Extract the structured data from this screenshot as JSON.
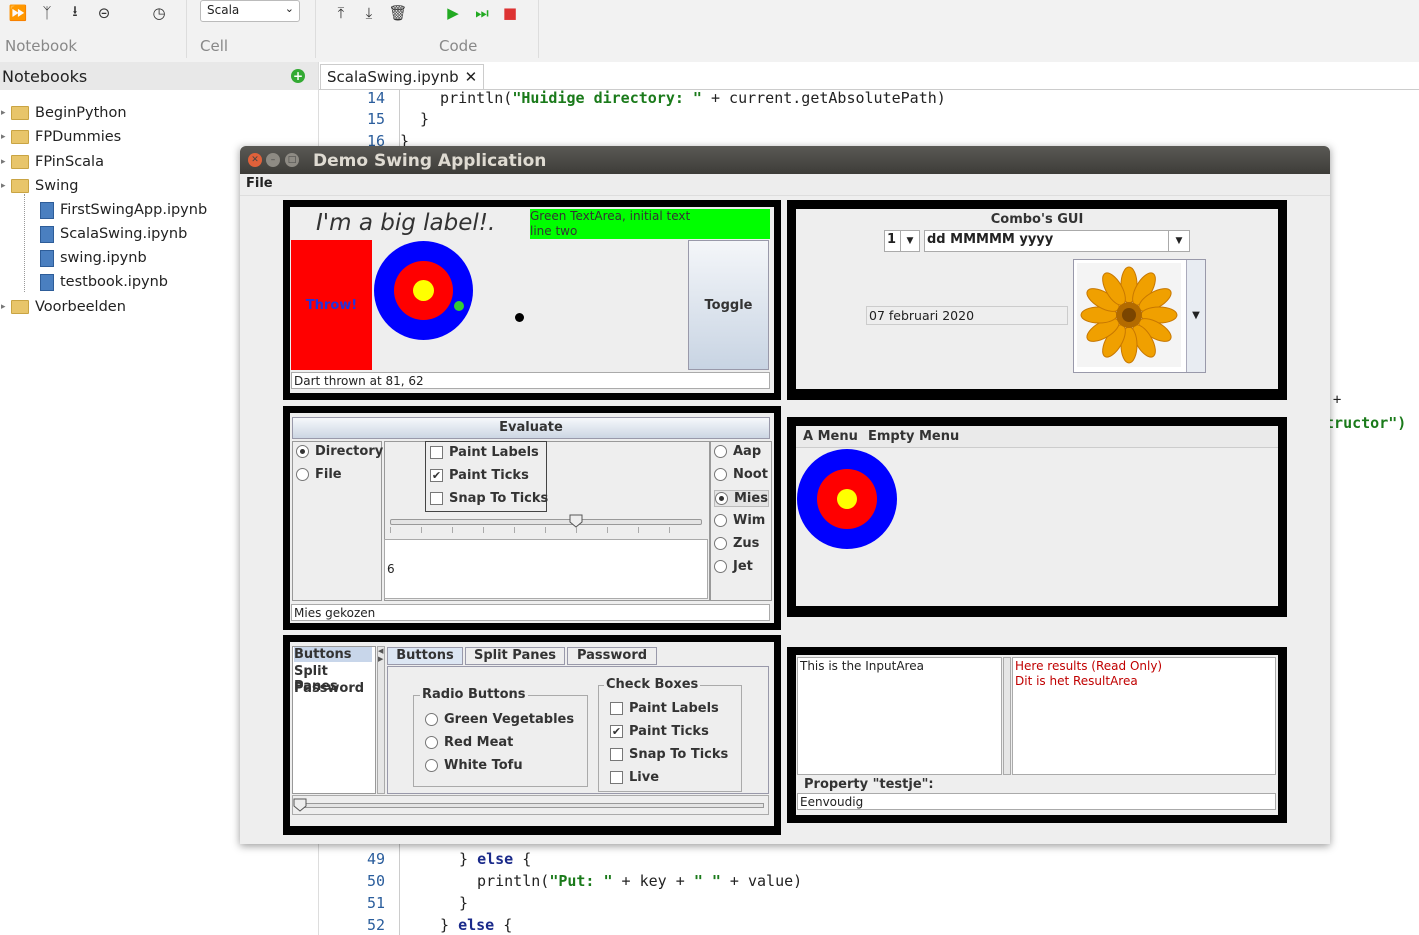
{
  "toolbar": {
    "groups": [
      "Notebook",
      "Cell",
      "Code"
    ],
    "kernel": "Scala",
    "icons": [
      "run-all-icon",
      "branch-icon",
      "download-icon",
      "stop-icon",
      "clock-icon",
      "move-up-icon",
      "move-down-icon",
      "delete-icon",
      "run-icon",
      "run-next-icon",
      "stop-square-icon"
    ]
  },
  "sidebar": {
    "title": "Notebooks",
    "items": [
      {
        "label": "BeginPython",
        "type": "folder"
      },
      {
        "label": "FPDummies",
        "type": "folder"
      },
      {
        "label": "FPinScala",
        "type": "folder"
      },
      {
        "label": "Swing",
        "type": "folder"
      },
      {
        "label": "FirstSwingApp.ipynb",
        "type": "notebook"
      },
      {
        "label": "ScalaSwing.ipynb",
        "type": "notebook"
      },
      {
        "label": "swing.ipynb",
        "type": "notebook"
      },
      {
        "label": "testbook.ipynb",
        "type": "notebook"
      },
      {
        "label": "Voorbeelden",
        "type": "folder"
      }
    ]
  },
  "editor": {
    "tab": "ScalaSwing.ipynb",
    "top_lines": [
      {
        "n": "14",
        "pre": "  println(",
        "str": "\"Huidige directory: \"",
        "post": " + current.getAbsolutePath)"
      },
      {
        "n": "15",
        "text": "}"
      },
      {
        "n": "16",
        "text": "}"
      }
    ],
    "right_fragments": [
      "n +",
      "structor\")"
    ],
    "bottom_lines": [
      {
        "n": "49",
        "kw_pre": "} ",
        "kw": "else",
        "post": " {"
      },
      {
        "n": "50",
        "pre": "  println(",
        "str": "\"Put: \"",
        "mid": " + key + ",
        "str2": "\" \"",
        "post": " + value)"
      },
      {
        "n": "51",
        "text": "}"
      },
      {
        "n": "52",
        "kw_pre": "} ",
        "kw": "else",
        "post": " {"
      }
    ]
  },
  "swing": {
    "title": "Demo Swing Application",
    "menu": "File",
    "p1": {
      "big_label": "I'm a big label!.",
      "green_text": "Green TextArea, initial text\nline two",
      "throw": "Throw!",
      "toggle": "Toggle",
      "status": "Dart thrown at 81, 62"
    },
    "p2": {
      "title": "Combo's GUI",
      "combo_num": "1",
      "combo_fmt": "dd MMMMM yyyy",
      "date": "07 februari 2020",
      "flower_icon": "flower-icon"
    },
    "p3": {
      "evaluate": "Evaluate",
      "left_radios": [
        {
          "label": "Directory",
          "on": true
        },
        {
          "label": "File",
          "on": false
        }
      ],
      "checks": [
        {
          "label": "Paint Labels",
          "on": false
        },
        {
          "label": "Paint Ticks",
          "on": true
        },
        {
          "label": "Snap To Ticks",
          "on": false
        }
      ],
      "slider_value": 0.6,
      "text_value": "6",
      "right_radios": [
        {
          "label": "Aap",
          "on": false
        },
        {
          "label": "Noot",
          "on": false
        },
        {
          "label": "Mies",
          "on": true
        },
        {
          "label": "Wim",
          "on": false
        },
        {
          "label": "Zus",
          "on": false
        },
        {
          "label": "Jet",
          "on": false
        }
      ],
      "status": "Mies gekozen"
    },
    "p4": {
      "menus": [
        "A Menu",
        "Empty Menu"
      ]
    },
    "p5": {
      "list": [
        "Buttons",
        "Split Panes",
        "Password"
      ],
      "tabs": [
        "Buttons",
        "Split Panes",
        "Password"
      ],
      "radio_title": "Radio Buttons",
      "radios": [
        "Green Vegetables",
        "Red Meat",
        "White Tofu"
      ],
      "check_title": "Check Boxes",
      "checks": [
        {
          "label": "Paint Labels",
          "on": false
        },
        {
          "label": "Paint Ticks",
          "on": true
        },
        {
          "label": "Snap To Ticks",
          "on": false
        },
        {
          "label": "Live",
          "on": false
        }
      ],
      "slider_value": 0
    },
    "p6": {
      "input": "This is the InputArea",
      "result": "Here results (Read Only)\nDit is het ResultArea",
      "property_label": "Property \"testje\":",
      "property_value": "Eenvoudig"
    }
  },
  "colors": {
    "accent_green": "#33aa33",
    "result_red": "#c00000",
    "target_blue": "#0000ff",
    "target_red": "#ff0000",
    "target_yellow": "#ffff00"
  }
}
